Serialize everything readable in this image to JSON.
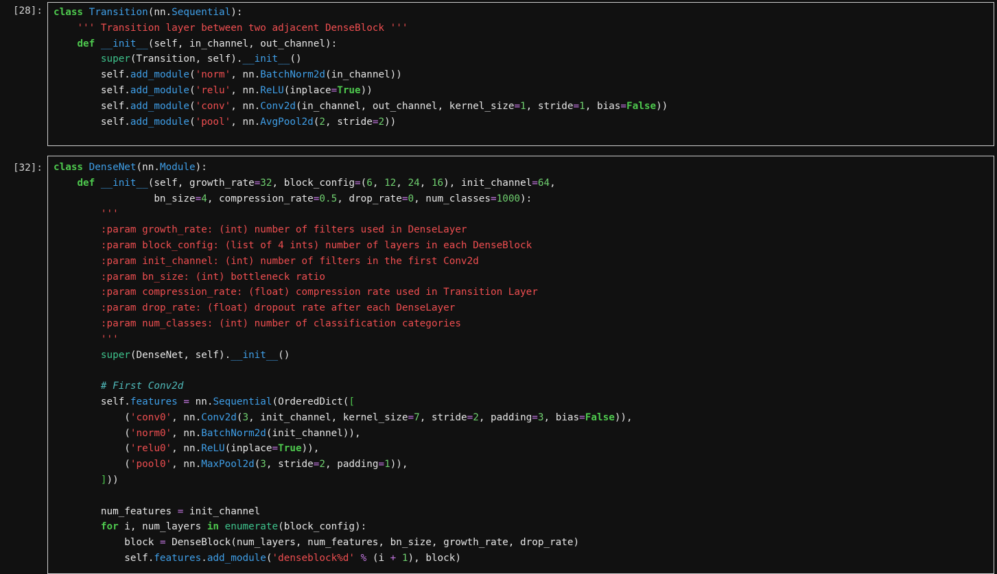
{
  "cells": [
    {
      "prompt": "[28]:",
      "lines": [
        [
          [
            "k",
            "class"
          ],
          [
            "t",
            " "
          ],
          [
            "cl",
            "Transition"
          ],
          [
            "t",
            "(nn."
          ],
          [
            "fn",
            "Sequential"
          ],
          [
            "t",
            "):"
          ]
        ],
        [
          [
            "t",
            "    "
          ],
          [
            "s",
            "''' Transition layer between two adjacent DenseBlock '''"
          ]
        ],
        [
          [
            "t",
            "    "
          ],
          [
            "k",
            "def"
          ],
          [
            "t",
            " "
          ],
          [
            "fn",
            "__init__"
          ],
          [
            "t",
            "(self, in_channel, out_channel):"
          ]
        ],
        [
          [
            "t",
            "        "
          ],
          [
            "b",
            "super"
          ],
          [
            "t",
            "(Transition, self)."
          ],
          [
            "fn",
            "__init__"
          ],
          [
            "t",
            "()"
          ]
        ],
        [
          [
            "t",
            "        self."
          ],
          [
            "fn",
            "add_module"
          ],
          [
            "t",
            "("
          ],
          [
            "s",
            "'norm'"
          ],
          [
            "t",
            ", nn."
          ],
          [
            "fn",
            "BatchNorm2d"
          ],
          [
            "t",
            "(in_channel))"
          ]
        ],
        [
          [
            "t",
            "        self."
          ],
          [
            "fn",
            "add_module"
          ],
          [
            "t",
            "("
          ],
          [
            "s",
            "'relu'"
          ],
          [
            "t",
            ", nn."
          ],
          [
            "fn",
            "ReLU"
          ],
          [
            "t",
            "(inplace"
          ],
          [
            "o",
            "="
          ],
          [
            "k",
            "True"
          ],
          [
            "t",
            "))"
          ]
        ],
        [
          [
            "t",
            "        self."
          ],
          [
            "fn",
            "add_module"
          ],
          [
            "t",
            "("
          ],
          [
            "s",
            "'conv'"
          ],
          [
            "t",
            ", nn."
          ],
          [
            "fn",
            "Conv2d"
          ],
          [
            "t",
            "(in_channel, out_channel, kernel_size"
          ],
          [
            "o",
            "="
          ],
          [
            "n",
            "1"
          ],
          [
            "t",
            ", stride"
          ],
          [
            "o",
            "="
          ],
          [
            "n",
            "1"
          ],
          [
            "t",
            ", bias"
          ],
          [
            "o",
            "="
          ],
          [
            "k",
            "False"
          ],
          [
            "t",
            "))"
          ]
        ],
        [
          [
            "t",
            "        self."
          ],
          [
            "fn",
            "add_module"
          ],
          [
            "t",
            "("
          ],
          [
            "s",
            "'pool'"
          ],
          [
            "t",
            ", nn."
          ],
          [
            "fn",
            "AvgPool2d"
          ],
          [
            "t",
            "("
          ],
          [
            "n",
            "2"
          ],
          [
            "t",
            ", stride"
          ],
          [
            "o",
            "="
          ],
          [
            "n",
            "2"
          ],
          [
            "t",
            "))"
          ]
        ],
        [
          [
            "t",
            ""
          ]
        ]
      ]
    },
    {
      "prompt": "[32]:",
      "lines": [
        [
          [
            "k",
            "class"
          ],
          [
            "t",
            " "
          ],
          [
            "cl",
            "DenseNet"
          ],
          [
            "t",
            "(nn."
          ],
          [
            "fn",
            "Module"
          ],
          [
            "t",
            "):"
          ]
        ],
        [
          [
            "t",
            "    "
          ],
          [
            "k",
            "def"
          ],
          [
            "t",
            " "
          ],
          [
            "fn",
            "__init__"
          ],
          [
            "t",
            "(self, growth_rate"
          ],
          [
            "o",
            "="
          ],
          [
            "n",
            "32"
          ],
          [
            "t",
            ", block_config"
          ],
          [
            "o",
            "="
          ],
          [
            "t",
            "("
          ],
          [
            "n",
            "6"
          ],
          [
            "t",
            ", "
          ],
          [
            "n",
            "12"
          ],
          [
            "t",
            ", "
          ],
          [
            "n",
            "24"
          ],
          [
            "t",
            ", "
          ],
          [
            "n",
            "16"
          ],
          [
            "t",
            "), init_channel"
          ],
          [
            "o",
            "="
          ],
          [
            "n",
            "64"
          ],
          [
            "t",
            ","
          ]
        ],
        [
          [
            "t",
            "                 bn_size"
          ],
          [
            "o",
            "="
          ],
          [
            "n",
            "4"
          ],
          [
            "t",
            ", compression_rate"
          ],
          [
            "o",
            "="
          ],
          [
            "n",
            "0.5"
          ],
          [
            "t",
            ", drop_rate"
          ],
          [
            "o",
            "="
          ],
          [
            "n",
            "0"
          ],
          [
            "t",
            ", num_classes"
          ],
          [
            "o",
            "="
          ],
          [
            "n",
            "1000"
          ],
          [
            "t",
            "):"
          ]
        ],
        [
          [
            "t",
            "        "
          ],
          [
            "s",
            "'''"
          ]
        ],
        [
          [
            "t",
            "        "
          ],
          [
            "s",
            ":param growth_rate: (int) number of filters used in DenseLayer"
          ]
        ],
        [
          [
            "t",
            "        "
          ],
          [
            "s",
            ":param block_config: (list of 4 ints) number of layers in each DenseBlock"
          ]
        ],
        [
          [
            "t",
            "        "
          ],
          [
            "s",
            ":param init_channel: (int) number of filters in the first Conv2d"
          ]
        ],
        [
          [
            "t",
            "        "
          ],
          [
            "s",
            ":param bn_size: (int) bottleneck ratio"
          ]
        ],
        [
          [
            "t",
            "        "
          ],
          [
            "s",
            ":param compression_rate: (float) compression rate used in Transition Layer"
          ]
        ],
        [
          [
            "t",
            "        "
          ],
          [
            "s",
            ":param drop_rate: (float) dropout rate after each DenseLayer"
          ]
        ],
        [
          [
            "t",
            "        "
          ],
          [
            "s",
            ":param num_classes: (int) number of classification categories"
          ]
        ],
        [
          [
            "t",
            "        "
          ],
          [
            "s",
            "'''"
          ]
        ],
        [
          [
            "t",
            "        "
          ],
          [
            "b",
            "super"
          ],
          [
            "t",
            "(DenseNet, self)."
          ],
          [
            "fn",
            "__init__"
          ],
          [
            "t",
            "()"
          ]
        ],
        [
          [
            "t",
            ""
          ]
        ],
        [
          [
            "t",
            "        "
          ],
          [
            "c",
            "# First Conv2d"
          ]
        ],
        [
          [
            "t",
            "        self."
          ],
          [
            "fn",
            "features"
          ],
          [
            "t",
            " "
          ],
          [
            "o",
            "="
          ],
          [
            "t",
            " nn."
          ],
          [
            "fn",
            "Sequential"
          ],
          [
            "t",
            "(OrderedDict("
          ],
          [
            "br",
            "["
          ]
        ],
        [
          [
            "t",
            "            ("
          ],
          [
            "s",
            "'conv0'"
          ],
          [
            "t",
            ", nn."
          ],
          [
            "fn",
            "Conv2d"
          ],
          [
            "t",
            "("
          ],
          [
            "n",
            "3"
          ],
          [
            "t",
            ", init_channel, kernel_size"
          ],
          [
            "o",
            "="
          ],
          [
            "n",
            "7"
          ],
          [
            "t",
            ", stride"
          ],
          [
            "o",
            "="
          ],
          [
            "n",
            "2"
          ],
          [
            "t",
            ", padding"
          ],
          [
            "o",
            "="
          ],
          [
            "n",
            "3"
          ],
          [
            "t",
            ", bias"
          ],
          [
            "o",
            "="
          ],
          [
            "k",
            "False"
          ],
          [
            "t",
            ")),"
          ]
        ],
        [
          [
            "t",
            "            ("
          ],
          [
            "s",
            "'norm0'"
          ],
          [
            "t",
            ", nn."
          ],
          [
            "fn",
            "BatchNorm2d"
          ],
          [
            "t",
            "(init_channel)),"
          ]
        ],
        [
          [
            "t",
            "            ("
          ],
          [
            "s",
            "'relu0'"
          ],
          [
            "t",
            ", nn."
          ],
          [
            "fn",
            "ReLU"
          ],
          [
            "t",
            "(inplace"
          ],
          [
            "o",
            "="
          ],
          [
            "k",
            "True"
          ],
          [
            "t",
            ")),"
          ]
        ],
        [
          [
            "t",
            "            ("
          ],
          [
            "s",
            "'pool0'"
          ],
          [
            "t",
            ", nn."
          ],
          [
            "fn",
            "MaxPool2d"
          ],
          [
            "t",
            "("
          ],
          [
            "n",
            "3"
          ],
          [
            "t",
            ", stride"
          ],
          [
            "o",
            "="
          ],
          [
            "n",
            "2"
          ],
          [
            "t",
            ", padding"
          ],
          [
            "o",
            "="
          ],
          [
            "n",
            "1"
          ],
          [
            "t",
            ")),"
          ]
        ],
        [
          [
            "t",
            "        "
          ],
          [
            "br",
            "]"
          ],
          [
            "t",
            "))"
          ]
        ],
        [
          [
            "t",
            ""
          ]
        ],
        [
          [
            "t",
            "        num_features "
          ],
          [
            "o",
            "="
          ],
          [
            "t",
            " init_channel"
          ]
        ],
        [
          [
            "t",
            "        "
          ],
          [
            "k",
            "for"
          ],
          [
            "t",
            " i, num_layers "
          ],
          [
            "k",
            "in"
          ],
          [
            "t",
            " "
          ],
          [
            "b",
            "enumerate"
          ],
          [
            "t",
            "(block_config):"
          ]
        ],
        [
          [
            "t",
            "            block "
          ],
          [
            "o",
            "="
          ],
          [
            "t",
            " DenseBlock(num_layers, num_features, bn_size, growth_rate, drop_rate)"
          ]
        ],
        [
          [
            "t",
            "            self."
          ],
          [
            "fn",
            "features"
          ],
          [
            "t",
            "."
          ],
          [
            "fn",
            "add_module"
          ],
          [
            "t",
            "("
          ],
          [
            "s",
            "'denseblock%d'"
          ],
          [
            "t",
            " "
          ],
          [
            "o",
            "%"
          ],
          [
            "t",
            " (i "
          ],
          [
            "o",
            "+"
          ],
          [
            "t",
            " "
          ],
          [
            "n",
            "1"
          ],
          [
            "t",
            "), block)"
          ]
        ]
      ]
    }
  ]
}
